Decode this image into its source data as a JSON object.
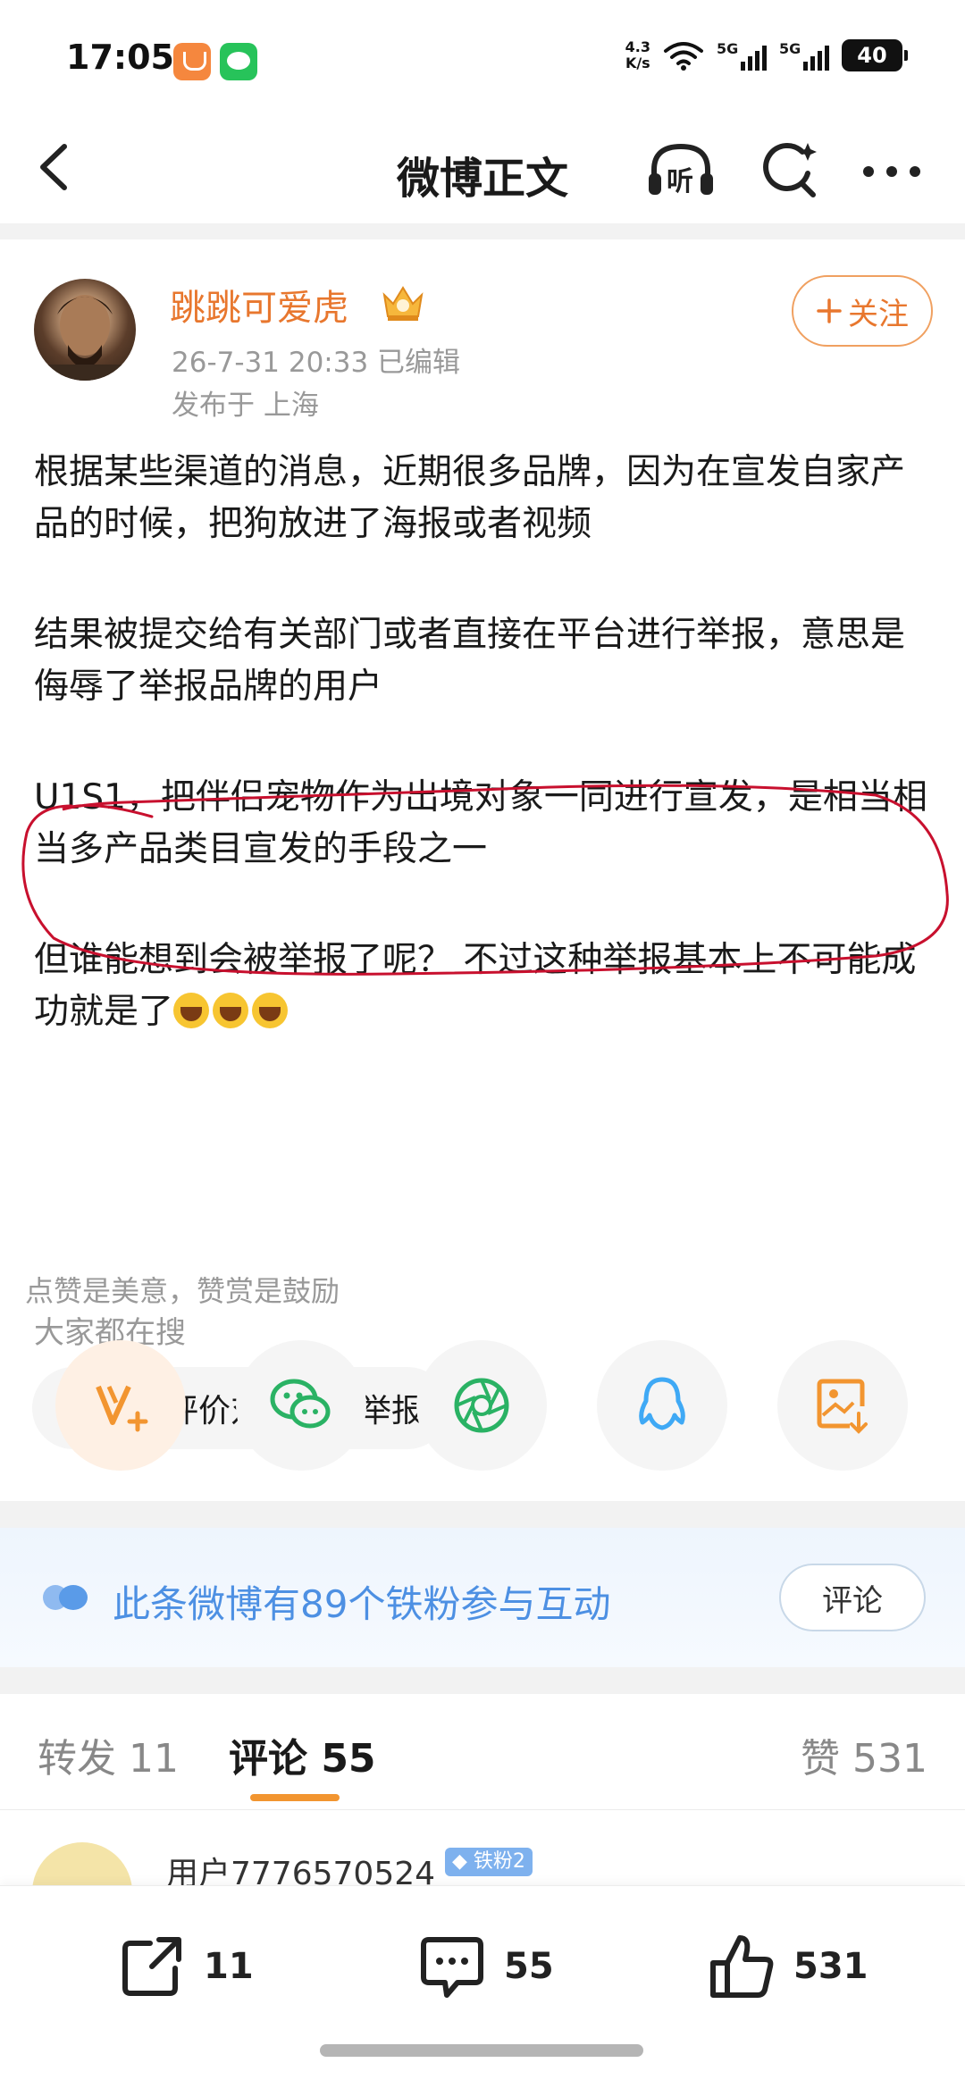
{
  "status_bar": {
    "time": "17:05",
    "net_speed_value": "4.3",
    "net_speed_unit": "K/s",
    "signal1_label": "5G",
    "signal2_label": "5G",
    "battery": "40"
  },
  "header": {
    "title": "微博正文",
    "listen_label": "听"
  },
  "post": {
    "author": "跳跳可爱虎",
    "meta": "26-7-31 20:33  已编辑",
    "location": "发布于 上海",
    "follow_label": "关注",
    "paragraphs": [
      "根据某些渠道的消息，近期很多品牌，因为在宣发自家产品的时候，把狗放进了海报或者视频",
      "结果被提交给有关部门或者直接在平台进行举报，意思是侮辱了举报品牌的用户",
      "U1S1，把伴侣宠物作为出境对象一同进行宣发，是相当相当多产品类目宣发的手段之一",
      "但谁能想到会被举报了呢？ 不过这种举报基本上不可能成功就是了"
    ],
    "search_label": "大家都在搜",
    "search_chip": "网友评价对号入座举报"
  },
  "share": {
    "tip": "点赞是美意，赞赏是鼓励",
    "buttons": [
      "reward",
      "wechat",
      "moments",
      "qq",
      "save-image"
    ]
  },
  "fans_banner": {
    "text": "此条微博有89个铁粉参与互动",
    "button": "评论"
  },
  "tabs": {
    "repost": "转发 11",
    "comment": "评论 55",
    "like": "赞 531"
  },
  "comment_preview": {
    "user": "用户7776570524",
    "badge": "铁粉2"
  },
  "bottom_bar": {
    "repost_count": "11",
    "comment_count": "55",
    "like_count": "531"
  },
  "colors": {
    "accent": "#e8772e",
    "link_blue": "#4d90e3",
    "tab_underline": "#f29530",
    "annotation_red": "#c8102e"
  }
}
